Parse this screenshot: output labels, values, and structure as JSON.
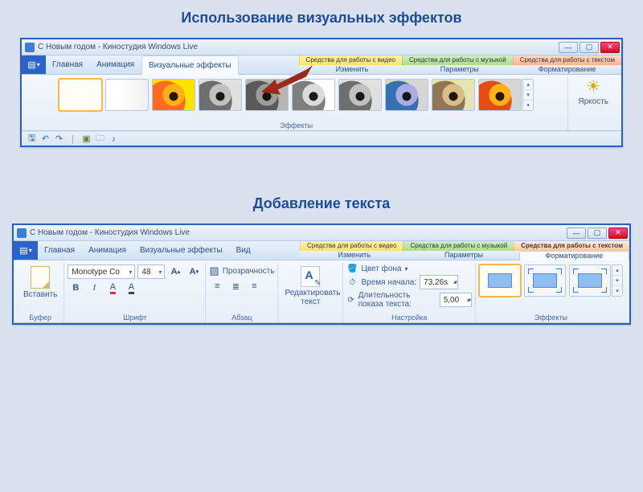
{
  "headings": {
    "effects": "Использование визуальных эффектов",
    "text": "Добавление текста"
  },
  "panel1": {
    "title": "С Новым годом - Киностудия Windows Live",
    "tabs": {
      "home": "Главная",
      "animation": "Анимация",
      "visual_fx": "Визуальные эффекты",
      "ctx_video": "Средства для работы с видео",
      "ctx_music": "Средства для работы с музыкой",
      "ctx_text": "Средства для работы с текстом",
      "ctx_video_sub": "Изменить",
      "ctx_music_sub": "Параметры",
      "ctx_text_sub": "Форматирование"
    },
    "groups": {
      "effects": "Эффекты"
    },
    "brightness": "Яркость"
  },
  "panel2": {
    "title": "С Новым годом - Киностудия Windows Live",
    "tabs": {
      "home": "Главная",
      "animation": "Анимация",
      "visual_fx": "Визуальные эффекты",
      "view": "Вид",
      "ctx_video": "Средства для работы с видео",
      "ctx_music": "Средства для работы с музыкой",
      "ctx_text": "Средства для работы с текстом",
      "ctx_video_sub": "Изменить",
      "ctx_music_sub": "Параметры",
      "ctx_text_sub": "Форматирование"
    },
    "groups": {
      "buffer": "Буфер",
      "font": "Шрифт",
      "paragraph": "Абзац",
      "settings": "Настройка",
      "effects": "Эффекты"
    },
    "paste": "Вставить",
    "font_name": "Monotype Co",
    "font_size": "48",
    "transparency": "Прозрачность",
    "edit_text": "Редактировать текст",
    "bg_color": "Цвет фона",
    "start_time_label": "Время начала:",
    "duration_label": "Длительность показа текста:",
    "start_time_value": "73,26s",
    "duration_value": "5,00"
  }
}
